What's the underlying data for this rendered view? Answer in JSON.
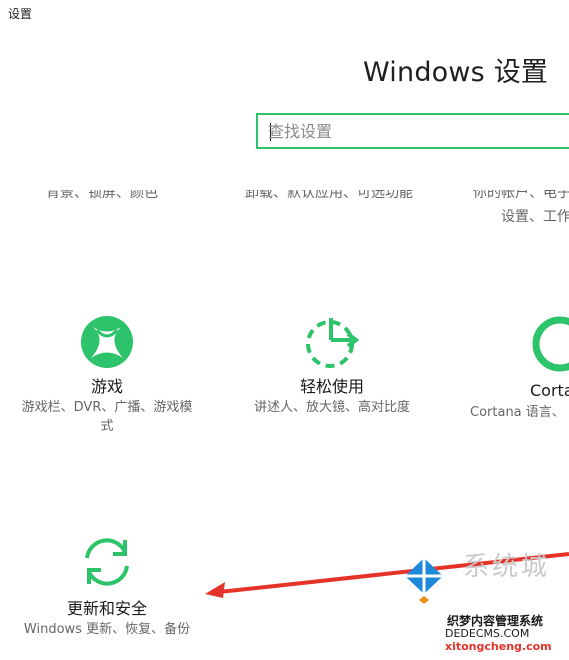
{
  "window": {
    "title": "设置"
  },
  "header": {
    "title": "Windows 设置"
  },
  "search": {
    "placeholder": "查找设置"
  },
  "clipped_rows": {
    "col1_desc": "背景、锁屏、颜色",
    "col2_desc": "卸载、默认应用、可选功能",
    "col3_desc": "你的帐户、电子邮件、同步",
    "col3_desc_line2": "设置、工作"
  },
  "tiles": [
    {
      "title": "游戏",
      "desc": "游戏栏、DVR、广播、游戏模式",
      "icon": "xbox-icon"
    },
    {
      "title": "轻松使用",
      "desc": "讲述人、放大镜、高对比度",
      "icon": "ease-of-access-icon"
    },
    {
      "title": "Cortana",
      "desc": "Cortana 语言、",
      "icon": "cortana-icon"
    },
    {
      "title": "更新和安全",
      "desc": "Windows 更新、恢复、备份",
      "icon": "update-sync-icon"
    }
  ],
  "watermark": {
    "big": "系统城",
    "line1": "织梦内容管理系统",
    "line2": "DEDECMS.COM",
    "line3": "xitongcheng.com"
  },
  "colors": {
    "accent": "#2dc36a",
    "arrow": "#e6332a",
    "text": "#1a1a1a",
    "subtext": "#666666"
  }
}
